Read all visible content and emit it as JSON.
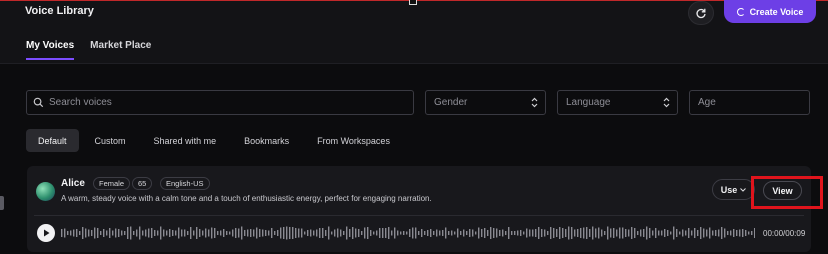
{
  "app": {
    "title": "Voice Library"
  },
  "header": {
    "create_label": "Create Voice"
  },
  "tabs": [
    {
      "label": "My Voices",
      "active": true
    },
    {
      "label": "Market Place",
      "active": false
    }
  ],
  "filters": {
    "search_placeholder": "Search voices",
    "gender_label": "Gender",
    "language_label": "Language",
    "age_placeholder": "Age"
  },
  "chips": [
    {
      "label": "Default"
    },
    {
      "label": "Custom"
    },
    {
      "label": "Shared with me"
    },
    {
      "label": "Bookmarks"
    },
    {
      "label": "From Workspaces"
    }
  ],
  "voice": {
    "name": "Alice",
    "gender": "Female",
    "age": "65",
    "language": "English-US",
    "description": "A warm, steady voice with a calm tone and a touch of enthusiastic energy, perfect for engaging narration.",
    "use_label": "Use",
    "view_label": "View",
    "time": "00:00/00:09"
  },
  "colors": {
    "accent": "#6d3fe6",
    "highlight": "#e0141c",
    "background": "#0c0c0e"
  }
}
